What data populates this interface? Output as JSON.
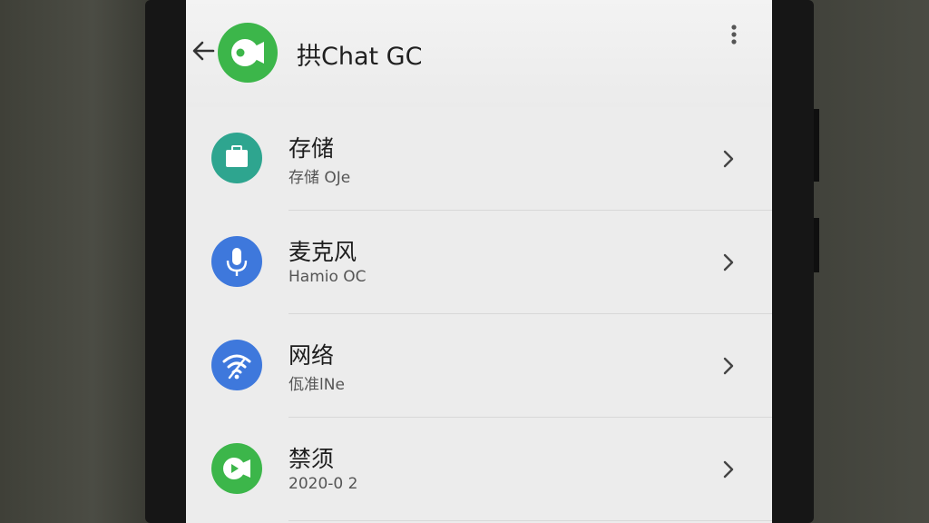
{
  "app_bar": {
    "title": "拱Chat GC",
    "back_icon": "arrow-left-icon",
    "app_icon": "video-chat-icon",
    "menu_icon": "more-vert-icon"
  },
  "settings": {
    "items": [
      {
        "label": "存储",
        "sub": "存储 OJe",
        "icon": "briefcase-icon",
        "color": "#2ea58f"
      },
      {
        "label": "麦克风",
        "sub": "Hamio OC",
        "icon": "microphone-icon",
        "color": "#3e78dc"
      },
      {
        "label": "网络",
        "sub": "佤准lNe",
        "icon": "wifi-icon",
        "color": "#3e78dc"
      },
      {
        "label": "禁须",
        "sub": "2020-0 2",
        "icon": "video-chat-icon",
        "color": "#3cb64a"
      }
    ]
  }
}
